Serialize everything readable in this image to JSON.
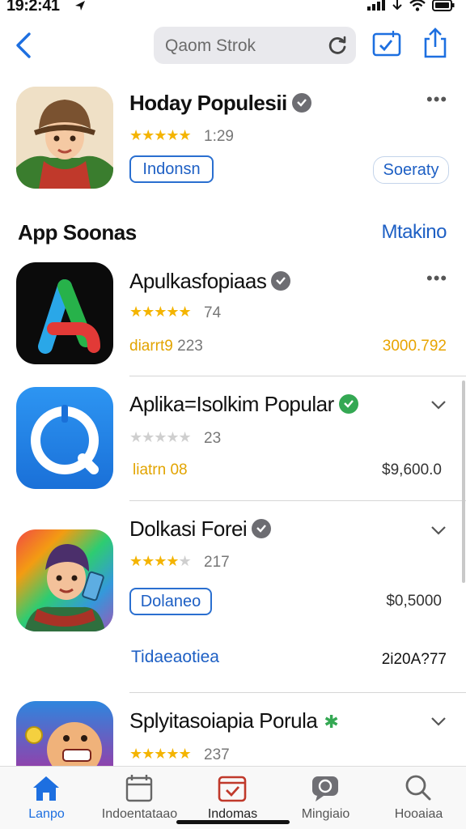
{
  "status": {
    "time": "19:2:41"
  },
  "nav": {
    "search_text": "Qaom Strok"
  },
  "featured": {
    "title": "Hoday Populesii",
    "rating_count": "1:29",
    "get_label": "Indonsn",
    "category_label": "Soeraty"
  },
  "section": {
    "title": "App Soonas",
    "see_all": "Mtakino"
  },
  "apps": [
    {
      "title": "Apulkasfopiaas",
      "rating_count": "74",
      "meta_gold": "diarrt9",
      "meta_grey": "223",
      "price": "3000.792"
    },
    {
      "title": "Aplika=Isolkim Popular",
      "rating_count": "23",
      "meta_gold": "liatrn 08",
      "price": "$9,600.0"
    },
    {
      "title": "Dolkasi Forei",
      "rating_count": "217",
      "get_label": "Dolaneo",
      "price": "$0,5000",
      "link_text": "Tidaeaotiea",
      "price_secondary": "2i20A?77"
    },
    {
      "title": "Splyitasoiapia Porula",
      "rating_count": "237"
    }
  ],
  "tabs": [
    {
      "label": "Lanpo",
      "icon": "home-icon",
      "active": true
    },
    {
      "label": "Indoentataao",
      "icon": "calendar-icon",
      "active": false
    },
    {
      "label": "Indomas",
      "icon": "check-calendar-icon",
      "active": false
    },
    {
      "label": "Mingiaio",
      "icon": "chat-icon",
      "active": false
    },
    {
      "label": "Hooaiaa",
      "icon": "search-icon",
      "active": false
    }
  ],
  "colors": {
    "accent": "#1d6fe0",
    "star": "#f4b400",
    "price_gold": "#e8a400"
  }
}
